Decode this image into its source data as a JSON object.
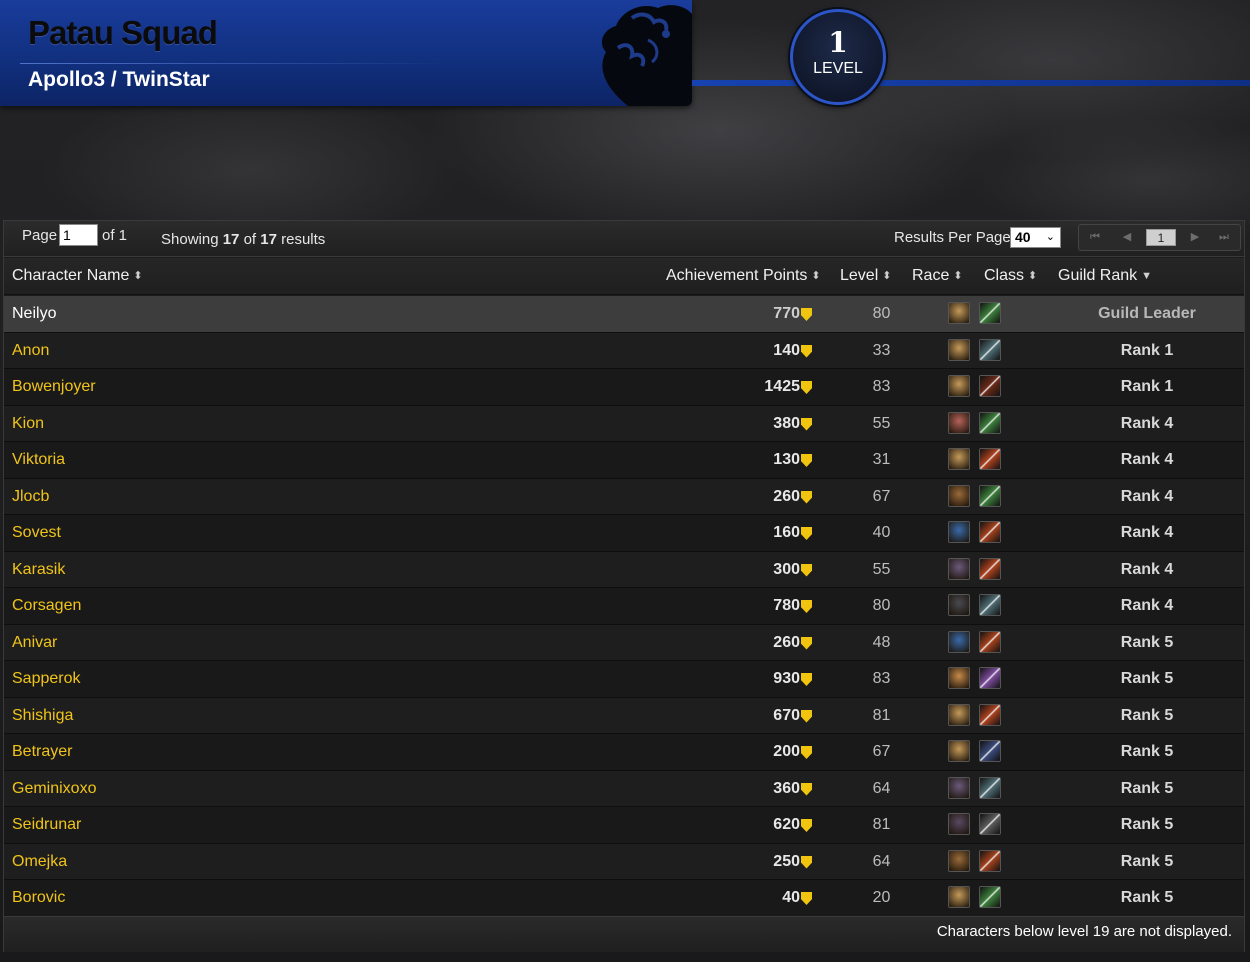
{
  "header": {
    "guild_name": "Patau Squad",
    "realm": "Apollo3 / TwinStar",
    "level_value": "1",
    "level_label": "LEVEL"
  },
  "pager": {
    "page_label": "Page",
    "page_value": "1",
    "of_label": "of 1",
    "showing_prefix": "Showing",
    "showing_count": "17",
    "showing_of": "of",
    "showing_total": "17",
    "showing_suffix": "results",
    "rpp_label": "Results Per Page",
    "rpp_value": "40",
    "current_page": "1",
    "nav_first": "⏮",
    "nav_prev": "◀",
    "nav_next": "▶",
    "nav_last": "⏭"
  },
  "columns": {
    "name": "Character Name",
    "points": "Achievement Points",
    "level": "Level",
    "race": "Race",
    "class": "Class",
    "rank": "Guild Rank"
  },
  "rows": [
    {
      "name": "Neilyo",
      "points": "770",
      "level": "80",
      "rank": "Guild Leader",
      "race_color": "#c69a5a",
      "class_color": "#3b7d3b"
    },
    {
      "name": "Anon",
      "points": "140",
      "level": "33",
      "rank": "Rank 1",
      "race_color": "#c69a5a",
      "class_color": "#4d6b72"
    },
    {
      "name": "Bowenjoyer",
      "points": "1425",
      "level": "83",
      "rank": "Rank 1",
      "race_color": "#c69a5a",
      "class_color": "#6a2a18"
    },
    {
      "name": "Kion",
      "points": "380",
      "level": "55",
      "rank": "Rank 4",
      "race_color": "#b5625a",
      "class_color": "#3b7d3b"
    },
    {
      "name": "Viktoria",
      "points": "130",
      "level": "31",
      "rank": "Rank 4",
      "race_color": "#c69a5a",
      "class_color": "#a8401e"
    },
    {
      "name": "Jlocb",
      "points": "260",
      "level": "67",
      "rank": "Rank 4",
      "race_color": "#9a6a3a",
      "class_color": "#3b7d3b"
    },
    {
      "name": "Sovest",
      "points": "160",
      "level": "40",
      "rank": "Rank 4",
      "race_color": "#3a6aa8",
      "class_color": "#a0401c"
    },
    {
      "name": "Karasik",
      "points": "300",
      "level": "55",
      "rank": "Rank 4",
      "race_color": "#6a5a7a",
      "class_color": "#a8401e"
    },
    {
      "name": "Corsagen",
      "points": "780",
      "level": "80",
      "rank": "Rank 4",
      "race_color": "#4a4a52",
      "class_color": "#4d6b72"
    },
    {
      "name": "Anivar",
      "points": "260",
      "level": "48",
      "rank": "Rank 5",
      "race_color": "#3a6aa8",
      "class_color": "#a0401c"
    },
    {
      "name": "Sapperok",
      "points": "930",
      "level": "83",
      "rank": "Rank 5",
      "race_color": "#c68a4a",
      "class_color": "#7a4a9a"
    },
    {
      "name": "Shishiga",
      "points": "670",
      "level": "81",
      "rank": "Rank 5",
      "race_color": "#c69a5a",
      "class_color": "#a8401e"
    },
    {
      "name": "Betrayer",
      "points": "200",
      "level": "67",
      "rank": "Rank 5",
      "race_color": "#c69a5a",
      "class_color": "#3a4a7a"
    },
    {
      "name": "Geminixoxo",
      "points": "360",
      "level": "64",
      "rank": "Rank 5",
      "race_color": "#6a5a7a",
      "class_color": "#4d6b72"
    },
    {
      "name": "Seidrunar",
      "points": "620",
      "level": "81",
      "rank": "Rank 5",
      "race_color": "#5a4a62",
      "class_color": "#5a5a5a"
    },
    {
      "name": "Omejka",
      "points": "250",
      "level": "64",
      "rank": "Rank 5",
      "race_color": "#9a6a3a",
      "class_color": "#a0401c"
    },
    {
      "name": "Borovic",
      "points": "40",
      "level": "20",
      "rank": "Rank 5",
      "race_color": "#c69a5a",
      "class_color": "#3b7d3b"
    }
  ],
  "footer": {
    "note": "Characters below level 19 are not displayed."
  },
  "colors": {
    "banner_blue": "#1a3c9c",
    "name_gold": "#f0c419",
    "shield_gold": "#f1c40f"
  },
  "icons": {
    "emblem": "alliance-emblem-icon",
    "points": "achievement-shield-icon",
    "sort": "sort-arrows-icon"
  }
}
